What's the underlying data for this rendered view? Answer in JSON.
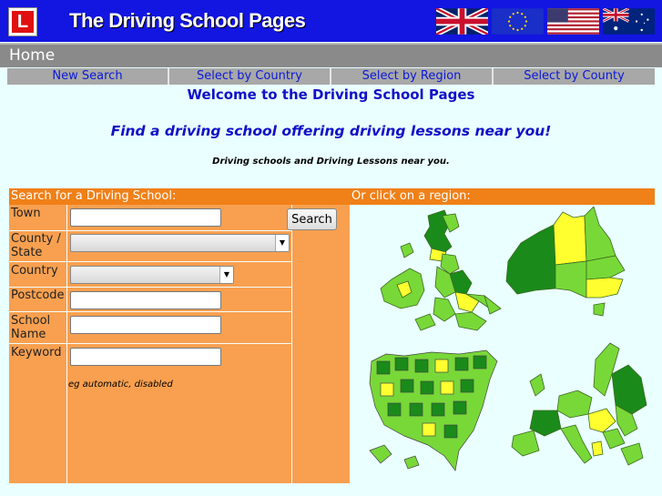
{
  "header": {
    "logo_letter": "L",
    "title": "The Driving School Pages",
    "flags": [
      "uk-flag-icon",
      "eu-flag-icon",
      "us-flag-icon",
      "australia-flag-icon"
    ]
  },
  "breadcrumb": {
    "home": "Home"
  },
  "nav": {
    "items": [
      {
        "label": "New Search"
      },
      {
        "label": "Select by Country"
      },
      {
        "label": "Select by Region"
      },
      {
        "label": "Select by County"
      }
    ]
  },
  "intro": {
    "welcome": "Welcome to the Driving School Pages",
    "tagline": "Find a driving school offering driving lessons near you!",
    "sub": "Driving schools and Driving Lessons near you."
  },
  "search": {
    "heading": "Search for a Driving School:",
    "fields": {
      "town": {
        "label": "Town",
        "value": ""
      },
      "county": {
        "label": "County / State",
        "value": ""
      },
      "country": {
        "label": "Country",
        "value": ""
      },
      "postcode": {
        "label": "Postcode",
        "value": ""
      },
      "school_name": {
        "label": "School Name",
        "value": ""
      },
      "keyword": {
        "label": "Keyword",
        "value": "",
        "hint": "eg automatic, disabled"
      }
    },
    "button_label": "Search"
  },
  "regions": {
    "heading": "Or click on a region:",
    "maps": [
      "uk-ireland-map",
      "australia-map",
      "usa-map",
      "europe-map"
    ]
  },
  "colors": {
    "header_bg": "#1216e0",
    "accent_orange": "#f08018",
    "panel_orange": "#f8a050",
    "link_blue": "#0a18d8",
    "map_green_light": "#7ee040",
    "map_green_dark": "#1a8a1a",
    "map_yellow": "#ffff30"
  }
}
